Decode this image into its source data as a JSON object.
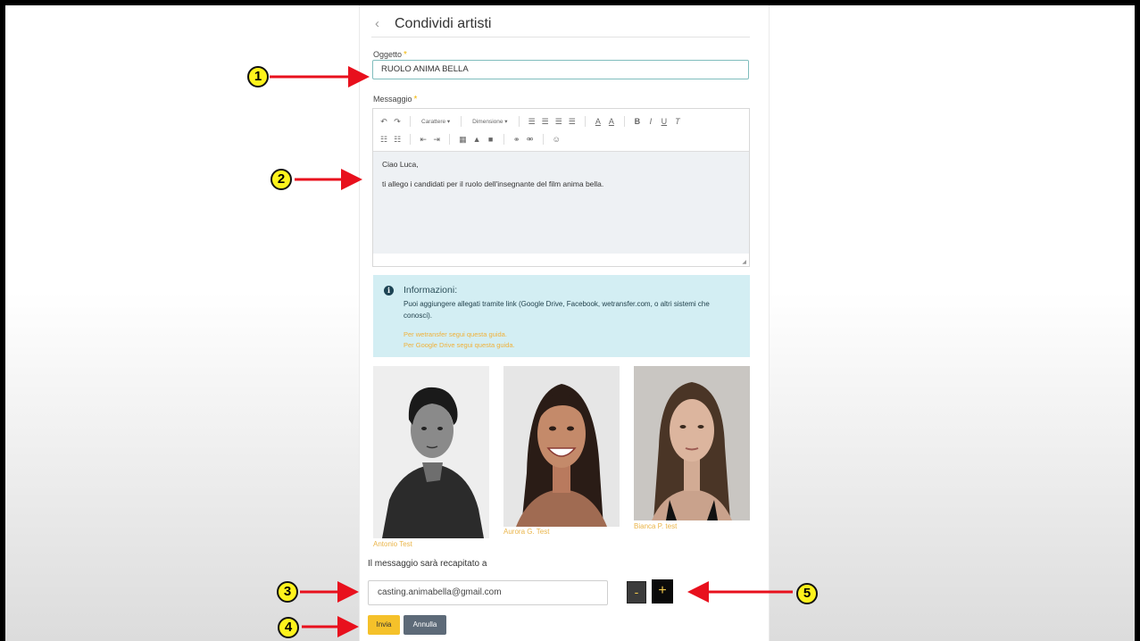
{
  "header": {
    "back_icon": "‹",
    "title": "Condividi artisti"
  },
  "subject": {
    "label": "Oggetto",
    "required_mark": "*",
    "value": "RUOLO ANIMA BELLA"
  },
  "message": {
    "label": "Messaggio",
    "required_mark": "*",
    "toolbar": {
      "font_dropdown": "Carattere ▾",
      "size_dropdown": "Dimensione ▾"
    },
    "body_lines": [
      "Ciao Luca,",
      "ti allego i candidati per il ruolo dell'insegnante del film anima bella."
    ]
  },
  "info": {
    "title": "Informazioni:",
    "text": "Puoi aggiungere allegati tramite link (Google Drive, Facebook, wetransfer.com, o altri sistemi che conosci).",
    "links": [
      "Per wetransfer segui questa guida.",
      "Per Google Drive segui questa guida."
    ]
  },
  "artists": [
    {
      "name": "Antonio Test"
    },
    {
      "name": "Aurora G. Test"
    },
    {
      "name": "Bianca P. test"
    }
  ],
  "recipient": {
    "label": "Il messaggio sarà recapitato a",
    "email": "casting.animabella@gmail.com",
    "remove_label": "-",
    "add_label": "+"
  },
  "actions": {
    "send_label": "Invia",
    "cancel_label": "Annulla"
  },
  "callouts": [
    "1",
    "2",
    "3",
    "4",
    "5"
  ],
  "colors": {
    "accent": "#f5c12a",
    "callout": "#fef31c",
    "arrow": "#e8101d",
    "info_bg": "#d3eef3"
  }
}
